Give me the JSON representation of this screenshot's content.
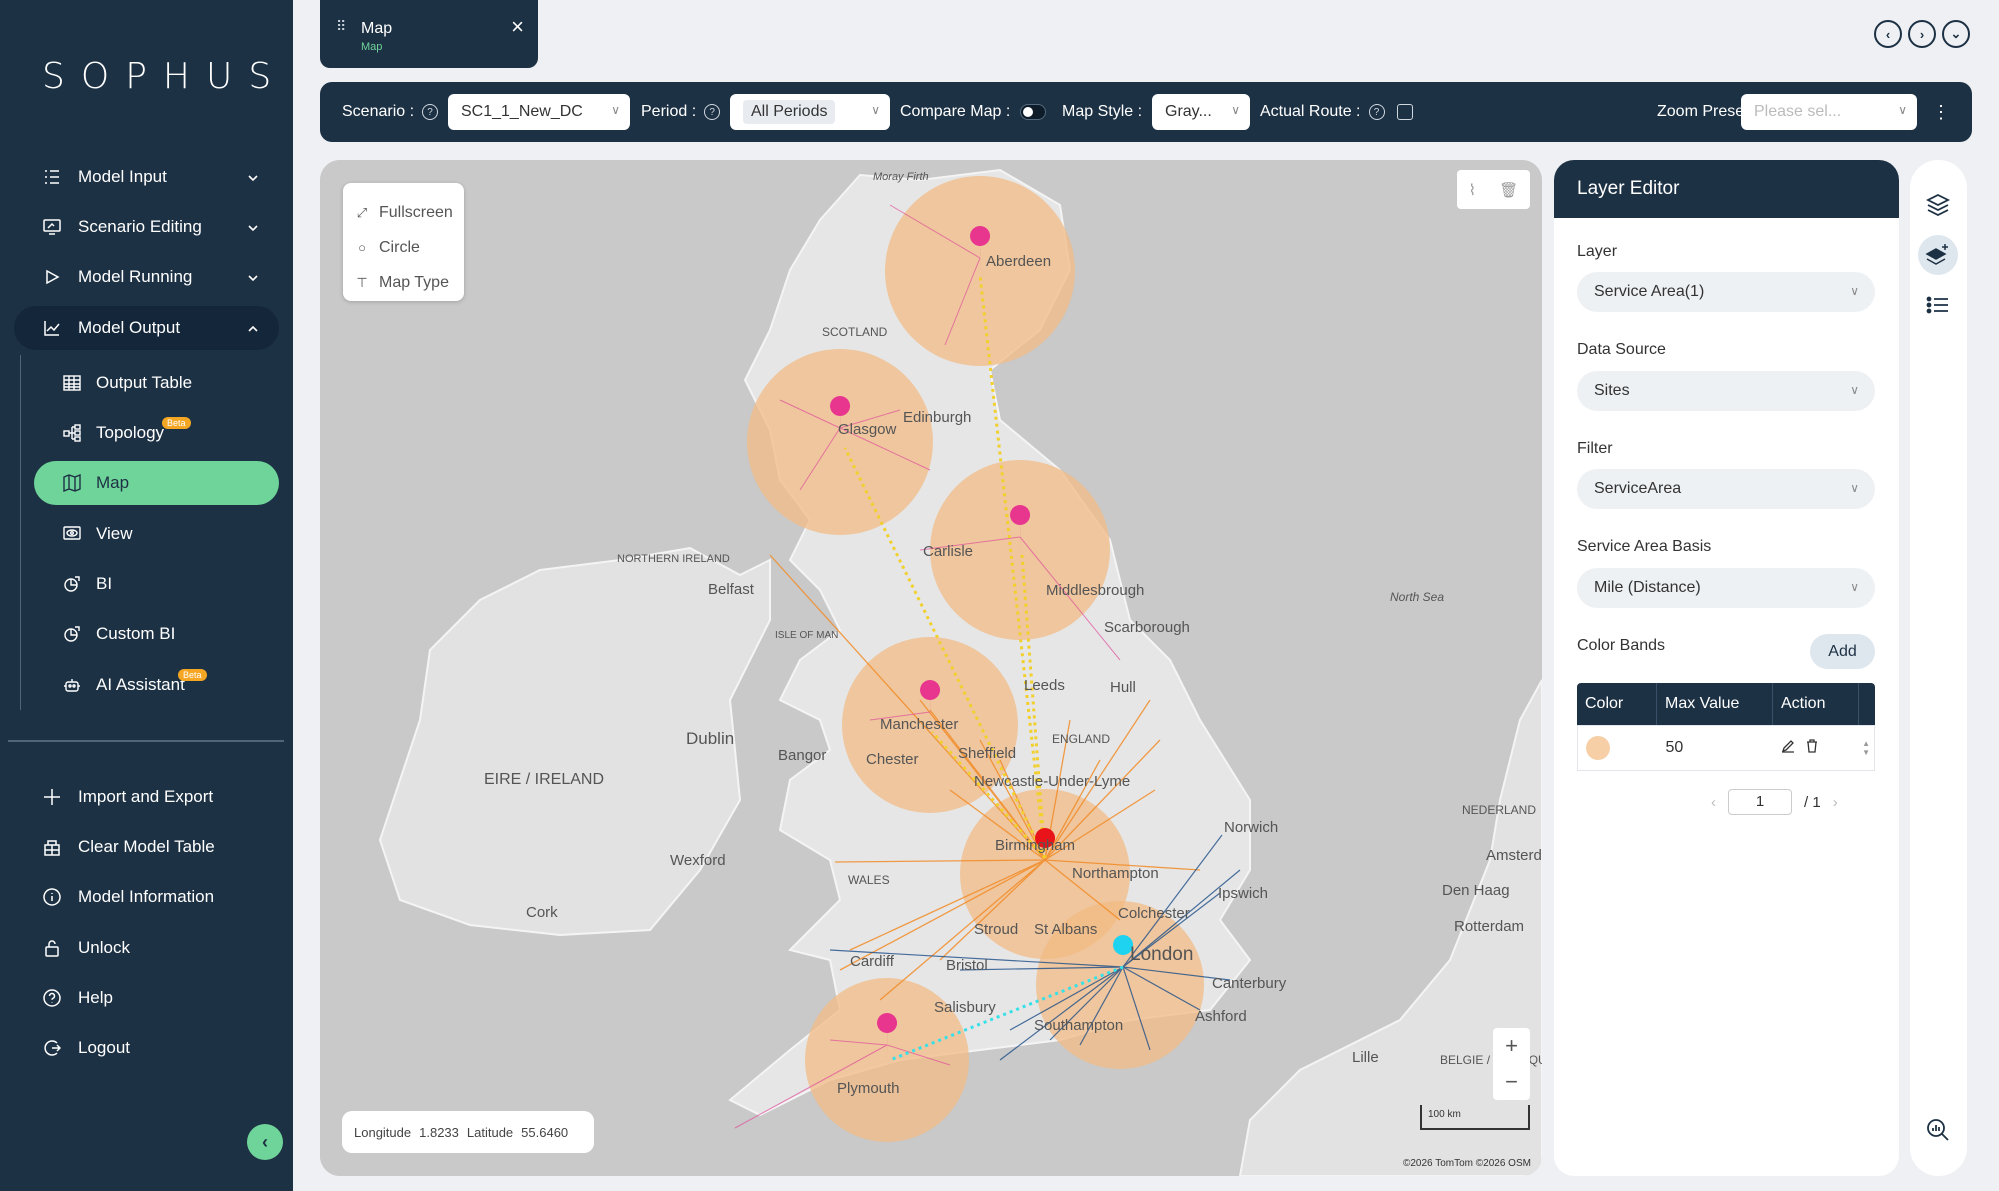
{
  "brand": "SOPHUS",
  "sidebar": {
    "items": [
      {
        "label": "Model Input",
        "icon": "list-icon"
      },
      {
        "label": "Scenario Editing",
        "icon": "monitor-edit-icon"
      },
      {
        "label": "Model Running",
        "icon": "play-icon"
      },
      {
        "label": "Model Output",
        "icon": "chart-line-icon"
      }
    ],
    "sub_items": [
      {
        "label": "Output Table",
        "icon": "table-icon"
      },
      {
        "label": "Topology",
        "icon": "topology-icon",
        "badge": "Beta"
      },
      {
        "label": "Map",
        "icon": "map-icon"
      },
      {
        "label": "View",
        "icon": "eye-icon"
      },
      {
        "label": "BI",
        "icon": "bi-icon"
      },
      {
        "label": "Custom BI",
        "icon": "custom-bi-icon"
      },
      {
        "label": "AI Assistant",
        "icon": "robot-icon",
        "badge": "Beta"
      }
    ],
    "bottom_items": [
      {
        "label": "Import and Export",
        "icon": "import-export-icon"
      },
      {
        "label": "Clear Model Table",
        "icon": "clear-table-icon"
      },
      {
        "label": "Model Information",
        "icon": "info-icon"
      },
      {
        "label": "Unlock",
        "icon": "unlock-icon"
      },
      {
        "label": "Help",
        "icon": "help-icon"
      },
      {
        "label": "Logout",
        "icon": "logout-icon"
      }
    ]
  },
  "tab": {
    "title": "Map",
    "subtitle": "Map"
  },
  "toolbar": {
    "scenario_label": "Scenario :",
    "scenario_value": "SC1_1_New_DC",
    "period_label": "Period :",
    "period_value": "All Periods",
    "compare_label": "Compare Map :",
    "style_label": "Map Style :",
    "style_value": "Gray...",
    "route_label": "Actual Route :",
    "zoom_label": "Zoom Presets :",
    "zoom_placeholder": "Please sel..."
  },
  "map": {
    "controls": [
      "Fullscreen",
      "Circle",
      "Map Type"
    ],
    "longitude_label": "Longitude",
    "longitude": "1.8233",
    "latitude_label": "Latitude",
    "latitude": "55.6460",
    "scale": "100 km",
    "attribution": "©2026 TomTom ©2026 OSM",
    "places": [
      {
        "name": "Moray Firth"
      },
      {
        "name": "Aberdeen"
      },
      {
        "name": "SCOTLAND"
      },
      {
        "name": "Edinburgh"
      },
      {
        "name": "Glasgow"
      },
      {
        "name": "NORTHERN IRELAND"
      },
      {
        "name": "Belfast"
      },
      {
        "name": "Carlisle"
      },
      {
        "name": "Middlesbrough"
      },
      {
        "name": "Scarborough"
      },
      {
        "name": "North Sea"
      },
      {
        "name": "ISLE OF MAN"
      },
      {
        "name": "Leeds"
      },
      {
        "name": "Hull"
      },
      {
        "name": "Manchester"
      },
      {
        "name": "Dublin"
      },
      {
        "name": "Bangor"
      },
      {
        "name": "Chester"
      },
      {
        "name": "Sheffield"
      },
      {
        "name": "ENGLAND"
      },
      {
        "name": "EIRE / IRELAND"
      },
      {
        "name": "Newcastle-Under-Lyme"
      },
      {
        "name": "Norwich"
      },
      {
        "name": "Birmingham"
      },
      {
        "name": "Northampton"
      },
      {
        "name": "Wexford"
      },
      {
        "name": "WALES"
      },
      {
        "name": "Ipswich"
      },
      {
        "name": "Cork"
      },
      {
        "name": "Colchester"
      },
      {
        "name": "Stroud"
      },
      {
        "name": "St Albans"
      },
      {
        "name": "London"
      },
      {
        "name": "Cardiff"
      },
      {
        "name": "Bristol"
      },
      {
        "name": "Canterbury"
      },
      {
        "name": "Salisbury"
      },
      {
        "name": "Ashford"
      },
      {
        "name": "Southampton"
      },
      {
        "name": "Plymouth"
      },
      {
        "name": "Lille"
      },
      {
        "name": "NEDERLAND"
      },
      {
        "name": "Amsterdam"
      },
      {
        "name": "Den Haag"
      },
      {
        "name": "Rotterdam"
      },
      {
        "name": "BELGIE / BELGIQUE"
      }
    ]
  },
  "layer_editor": {
    "title": "Layer Editor",
    "layer_label": "Layer",
    "layer_value": "Service Area(1)",
    "source_label": "Data Source",
    "source_value": "Sites",
    "filter_label": "Filter",
    "filter_value": "ServiceArea",
    "basis_label": "Service Area Basis",
    "basis_value": "Mile (Distance)",
    "bands_label": "Color Bands",
    "add_label": "Add",
    "columns": [
      "Color",
      "Max Value",
      "Action"
    ],
    "rows": [
      {
        "color": "#f7cfa6",
        "max_value": "50"
      }
    ],
    "page_current": "1",
    "page_total": "/ 1"
  },
  "colors": {
    "sidebar": "#1d3144",
    "accent": "#6fd49a",
    "service_area": "#f2bb84",
    "dc_pin": "#e8368f",
    "hub_pin": "#e8141a",
    "london_pin": "#1ed3f0"
  }
}
